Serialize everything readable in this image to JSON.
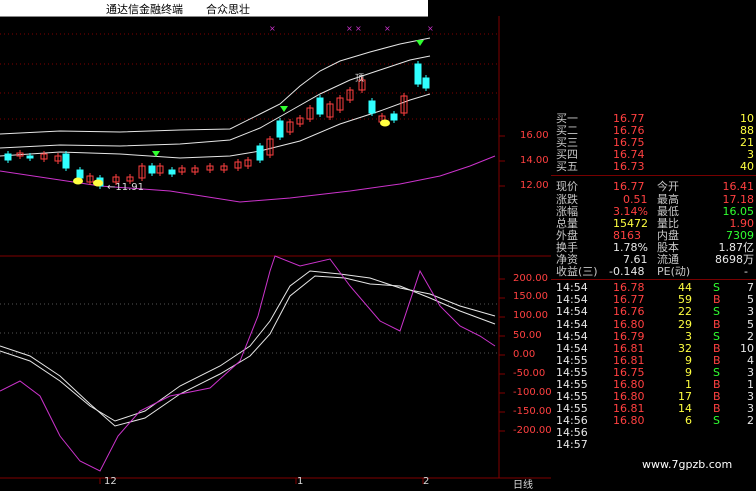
{
  "title": {
    "app": "通达信金融终端",
    "stock": "合众思壮"
  },
  "price_axis": [
    "16.00",
    "14.00",
    "12.00"
  ],
  "price_markers": {
    "low_label": "←11.91",
    "high_marker": "顶"
  },
  "macd_axis": [
    "200.00",
    "150.00",
    "100.00",
    "50.00",
    "0.00",
    "-50.00",
    "-100.00",
    "-150.00",
    "-200.00"
  ],
  "x_labels": [
    "12",
    "1",
    "2"
  ],
  "period_tab": "日线",
  "watermark": "www.7gpzb.com",
  "bids": [
    {
      "label": "买一",
      "price": "16.77",
      "vol": "10"
    },
    {
      "label": "买二",
      "price": "16.76",
      "vol": "88"
    },
    {
      "label": "买三",
      "price": "16.75",
      "vol": "21"
    },
    {
      "label": "买四",
      "price": "16.74",
      "vol": "3"
    },
    {
      "label": "买五",
      "price": "16.73",
      "vol": "40"
    }
  ],
  "stats": [
    {
      "l1": "现价",
      "v1": "16.77",
      "l2": "今开",
      "v2": "16.41"
    },
    {
      "l1": "涨跌",
      "v1": "0.51",
      "l2": "最高",
      "v2": "17.18"
    },
    {
      "l1": "涨幅",
      "v1": "3.14%",
      "l2": "最低",
      "v2": "16.05"
    },
    {
      "l1": "总量",
      "v1": "15472",
      "l2": "量比",
      "v2": "1.90"
    },
    {
      "l1": "外盘",
      "v1": "8163",
      "l2": "内盘",
      "v2": "7309"
    },
    {
      "l1": "换手",
      "v1": "1.78%",
      "l2": "股本",
      "v2": "1.87亿"
    },
    {
      "l1": "净资",
      "v1": "7.61",
      "l2": "流通",
      "v2": "8698万"
    },
    {
      "l1": "收益(三)",
      "v1": "-0.148",
      "l2": "PE(动)",
      "v2": "-"
    }
  ],
  "ticks": [
    {
      "time": "14:54",
      "price": "16.78",
      "vol": "44",
      "bs": "S",
      "n": "7"
    },
    {
      "time": "14:54",
      "price": "16.77",
      "vol": "59",
      "bs": "B",
      "n": "5"
    },
    {
      "time": "14:54",
      "price": "16.76",
      "vol": "22",
      "bs": "S",
      "n": "3"
    },
    {
      "time": "14:54",
      "price": "16.80",
      "vol": "29",
      "bs": "B",
      "n": "5"
    },
    {
      "time": "14:54",
      "price": "16.79",
      "vol": "3",
      "bs": "S",
      "n": "2"
    },
    {
      "time": "14:54",
      "price": "16.81",
      "vol": "32",
      "bs": "B",
      "n": "10"
    },
    {
      "time": "14:55",
      "price": "16.81",
      "vol": "9",
      "bs": "B",
      "n": "4"
    },
    {
      "time": "14:55",
      "price": "16.75",
      "vol": "9",
      "bs": "S",
      "n": "3"
    },
    {
      "time": "14:55",
      "price": "16.80",
      "vol": "1",
      "bs": "B",
      "n": "1"
    },
    {
      "time": "14:55",
      "price": "16.80",
      "vol": "17",
      "bs": "B",
      "n": "3"
    },
    {
      "time": "14:55",
      "price": "16.81",
      "vol": "14",
      "bs": "B",
      "n": "3"
    },
    {
      "time": "14:56",
      "price": "16.80",
      "vol": "6",
      "bs": "S",
      "n": "2"
    },
    {
      "time": "14:56",
      "price": "",
      "vol": "",
      "bs": "",
      "n": ""
    },
    {
      "time": "14:57",
      "price": "",
      "vol": "",
      "bs": "",
      "n": ""
    }
  ],
  "colors": {
    "up": "#ff4040",
    "down": "#30ffff",
    "macd_dif": "#ffffff",
    "macd_k": "#cc33cc",
    "grid": "#800000"
  }
}
